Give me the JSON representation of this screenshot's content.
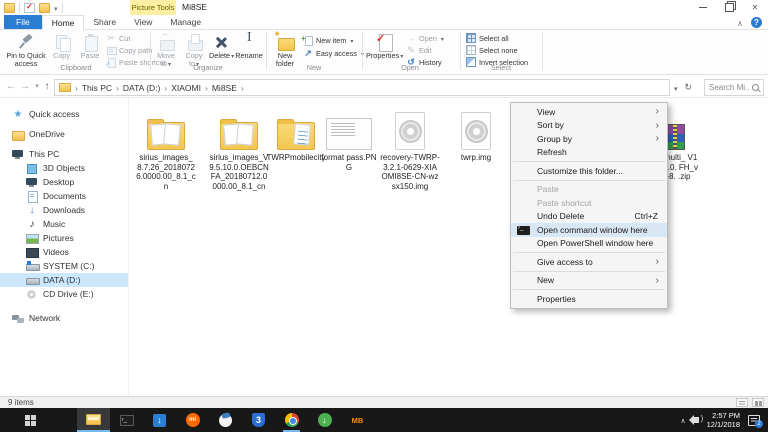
{
  "titlebar": {
    "context_label": "Picture Tools",
    "title": "Mi8SE"
  },
  "tabs": {
    "file": "File",
    "home": "Home",
    "share": "Share",
    "view": "View",
    "manage": "Manage"
  },
  "ribbon": {
    "clipboard": {
      "label": "Clipboard",
      "pin": "Pin to Quick access",
      "copy": "Copy",
      "paste": "Paste",
      "cut": "Cut",
      "copy_path": "Copy path",
      "paste_shortcut": "Paste shortcut"
    },
    "organize": {
      "label": "Organize",
      "move_to": "Move to",
      "copy_to": "Copy to",
      "delete": "Delete",
      "rename": "Rename"
    },
    "new": {
      "label": "New",
      "new_folder": "New folder",
      "new_item": "New item",
      "easy_access": "Easy access"
    },
    "open": {
      "label": "Open",
      "properties": "Properties",
      "open": "Open",
      "edit": "Edit",
      "history": "History"
    },
    "select": {
      "label": "Select",
      "select_all": "Select all",
      "select_none": "Select none",
      "invert": "Invert selection"
    }
  },
  "address": {
    "crumbs": [
      "This PC",
      "DATA (D:)",
      "XIAOMI",
      "Mi8SE"
    ],
    "search_placeholder": "Search Mi..."
  },
  "sidebar": {
    "items": [
      {
        "label": "Quick access",
        "icon": "star-icon"
      },
      {
        "label": "OneDrive",
        "icon": "folder-icon"
      },
      {
        "label": "This PC",
        "icon": "computer-icon"
      },
      {
        "label": "3D Objects",
        "icon": "cube-icon"
      },
      {
        "label": "Desktop",
        "icon": "monitor-icon"
      },
      {
        "label": "Documents",
        "icon": "document-icon"
      },
      {
        "label": "Downloads",
        "icon": "download-icon"
      },
      {
        "label": "Music",
        "icon": "music-icon"
      },
      {
        "label": "Pictures",
        "icon": "picture-icon"
      },
      {
        "label": "Videos",
        "icon": "video-icon"
      },
      {
        "label": "SYSTEM (C:)",
        "icon": "system-drive-icon"
      },
      {
        "label": "DATA (D:)",
        "icon": "drive-icon",
        "selected": true
      },
      {
        "label": "CD Drive (E:)",
        "icon": "cd-drive-icon"
      },
      {
        "label": "Network",
        "icon": "network-icon"
      }
    ]
  },
  "files": [
    {
      "name": "sirius_images_8.7.26_20180726.0000.00_8.1_cn",
      "type": "picture-folder"
    },
    {
      "name": "sirius_images_V9.5.10.0.OEBCNFA_20180712.0000.00_8.1_cn",
      "type": "picture-folder"
    },
    {
      "name": "TWRPmobilecity",
      "type": "document-folder"
    },
    {
      "name": "format pass.PNG",
      "type": "image-file"
    },
    {
      "name": "recovery-TWRP-3.2.1-0629-XIAOMI8SE-CN-wzsx150.img",
      "type": "disc-image-file"
    },
    {
      "name": "twrp.img",
      "type": "disc-image-file"
    },
    {
      "name": "eu_multi_ V10.0.1.0. FH_v10-8. .zip",
      "type": "zip-archive"
    }
  ],
  "context_menu": {
    "items": [
      {
        "label": "View",
        "submenu": true
      },
      {
        "label": "Sort by",
        "submenu": true
      },
      {
        "label": "Group by",
        "submenu": true
      },
      {
        "label": "Refresh"
      },
      {
        "label": "Customize this folder..."
      },
      {
        "label": "Paste",
        "disabled": true
      },
      {
        "label": "Paste shortcut",
        "disabled": true
      },
      {
        "label": "Undo Delete",
        "shortcut": "Ctrl+Z"
      },
      {
        "label": "Open command window here",
        "highlighted": true,
        "icon": "cmd-icon"
      },
      {
        "label": "Open PowerShell window here"
      },
      {
        "label": "Give access to",
        "submenu": true
      },
      {
        "label": "New",
        "submenu": true
      },
      {
        "label": "Properties"
      }
    ]
  },
  "statusbar": {
    "count": "9 items"
  },
  "taskbar": {
    "mi_label": "mi",
    "browser3_label": "3",
    "mb_label": "MB",
    "clock_time": "2:57 PM",
    "clock_date": "12/1/2018",
    "badge": "2"
  }
}
